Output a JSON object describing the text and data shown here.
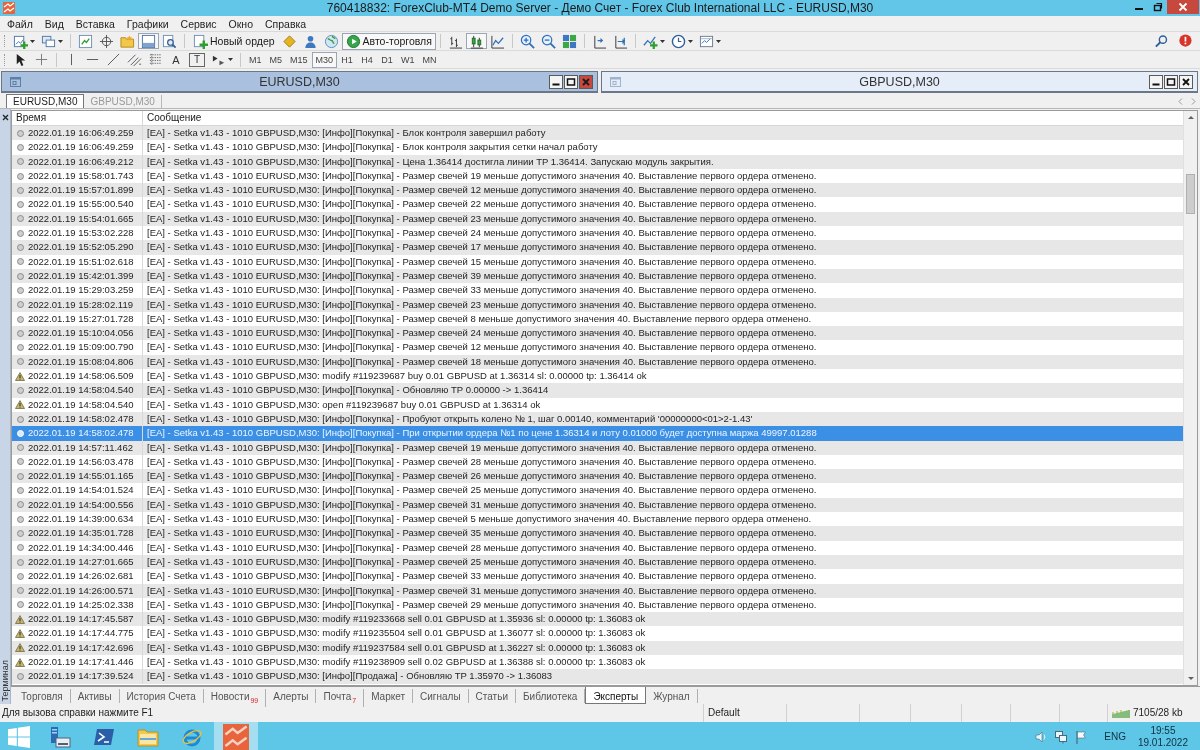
{
  "window": {
    "title": "760418832: ForexClub-MT4 Demo Server - Демо Счет - Forex Club International LLC - EURUSD,M30"
  },
  "menu": [
    "Файл",
    "Вид",
    "Вставка",
    "Графики",
    "Сервис",
    "Окно",
    "Справка"
  ],
  "toolbar": {
    "terminal_view": {
      "on": true
    },
    "new_order": "Новый ордер",
    "auto_trading": {
      "label": "Авто-торговля",
      "on": true
    },
    "chart_types": [
      {
        "selected": false
      },
      {
        "selected": true
      },
      {
        "selected": false
      }
    ]
  },
  "drawing_toolbar": {
    "text_tool": "A",
    "label_tool": "T",
    "timeframes": [
      {
        "label": "M1",
        "selected": false
      },
      {
        "label": "M5",
        "selected": false
      },
      {
        "label": "M15",
        "selected": false
      },
      {
        "label": "M30",
        "selected": true
      },
      {
        "label": "H1",
        "selected": false
      },
      {
        "label": "H4",
        "selected": false
      },
      {
        "label": "D1",
        "selected": false
      },
      {
        "label": "W1",
        "selected": false
      },
      {
        "label": "MN",
        "selected": false
      }
    ]
  },
  "chart_windows": [
    {
      "title": "EURUSD,M30",
      "active": true
    },
    {
      "title": "GBPUSD,M30",
      "active": false
    }
  ],
  "chart_tabs": [
    {
      "label": "EURUSD,M30",
      "selected": true
    },
    {
      "label": "GBPUSD,M30",
      "selected": false
    }
  ],
  "terminal": {
    "label": "Терминал",
    "columns": [
      "Время",
      "Сообщение"
    ],
    "rows": [
      {
        "kind": "info",
        "time": "2022.01.19 16:06:49.259",
        "message": "[EA] - Setka v1.43 - 1010 GBPUSD,M30: [Инфо][Покупка] - Блок контроля завершил работу",
        "selected": false
      },
      {
        "kind": "info",
        "time": "2022.01.19 16:06:49.259",
        "message": "[EA] - Setka v1.43 - 1010 GBPUSD,M30: [Инфо][Покупка] - Блок контроля закрытия сетки начал работу",
        "selected": false
      },
      {
        "kind": "info",
        "time": "2022.01.19 16:06:49.212",
        "message": "[EA] - Setka v1.43 - 1010 GBPUSD,M30: [Инфо][Покупка] - Цена 1.36414 достигла линии TP 1.36414. Запускаю модуль закрытия.",
        "selected": false
      },
      {
        "kind": "info",
        "time": "2022.01.19 15:58:01.743",
        "message": "[EA] - Setka v1.43 - 1010 EURUSD,M30: [Инфо][Покупка] - Размер свечей 19 меньше допустимого значения 40. Выставление первого ордера отменено.",
        "selected": false
      },
      {
        "kind": "info",
        "time": "2022.01.19 15:57:01.899",
        "message": "[EA] - Setka v1.43 - 1010 EURUSD,M30: [Инфо][Покупка] - Размер свечей 12 меньше допустимого значения 40. Выставление первого ордера отменено.",
        "selected": false
      },
      {
        "kind": "info",
        "time": "2022.01.19 15:55:00.540",
        "message": "[EA] - Setka v1.43 - 1010 EURUSD,M30: [Инфо][Покупка] - Размер свечей 22 меньше допустимого значения 40. Выставление первого ордера отменено.",
        "selected": false
      },
      {
        "kind": "info",
        "time": "2022.01.19 15:54:01.665",
        "message": "[EA] - Setka v1.43 - 1010 EURUSD,M30: [Инфо][Покупка] - Размер свечей 23 меньше допустимого значения 40. Выставление первого ордера отменено.",
        "selected": false
      },
      {
        "kind": "info",
        "time": "2022.01.19 15:53:02.228",
        "message": "[EA] - Setka v1.43 - 1010 EURUSD,M30: [Инфо][Покупка] - Размер свечей 24 меньше допустимого значения 40. Выставление первого ордера отменено.",
        "selected": false
      },
      {
        "kind": "info",
        "time": "2022.01.19 15:52:05.290",
        "message": "[EA] - Setka v1.43 - 1010 EURUSD,M30: [Инфо][Покупка] - Размер свечей 17 меньше допустимого значения 40. Выставление первого ордера отменено.",
        "selected": false
      },
      {
        "kind": "info",
        "time": "2022.01.19 15:51:02.618",
        "message": "[EA] - Setka v1.43 - 1010 EURUSD,M30: [Инфо][Покупка] - Размер свечей 15 меньше допустимого значения 40. Выставление первого ордера отменено.",
        "selected": false
      },
      {
        "kind": "info",
        "time": "2022.01.19 15:42:01.399",
        "message": "[EA] - Setka v1.43 - 1010 EURUSD,M30: [Инфо][Покупка] - Размер свечей 39 меньше допустимого значения 40. Выставление первого ордера отменено.",
        "selected": false
      },
      {
        "kind": "info",
        "time": "2022.01.19 15:29:03.259",
        "message": "[EA] - Setka v1.43 - 1010 EURUSD,M30: [Инфо][Покупка] - Размер свечей 33 меньше допустимого значения 40. Выставление первого ордера отменено.",
        "selected": false
      },
      {
        "kind": "info",
        "time": "2022.01.19 15:28:02.119",
        "message": "[EA] - Setka v1.43 - 1010 EURUSD,M30: [Инфо][Покупка] - Размер свечей 23 меньше допустимого значения 40. Выставление первого ордера отменено.",
        "selected": false
      },
      {
        "kind": "info",
        "time": "2022.01.19 15:27:01.728",
        "message": "[EA] - Setka v1.43 - 1010 EURUSD,M30: [Инфо][Покупка] - Размер свечей 8 меньше допустимого значения 40. Выставление первого ордера отменено.",
        "selected": false
      },
      {
        "kind": "info",
        "time": "2022.01.19 15:10:04.056",
        "message": "[EA] - Setka v1.43 - 1010 EURUSD,M30: [Инфо][Покупка] - Размер свечей 24 меньше допустимого значения 40. Выставление первого ордера отменено.",
        "selected": false
      },
      {
        "kind": "info",
        "time": "2022.01.19 15:09:00.790",
        "message": "[EA] - Setka v1.43 - 1010 EURUSD,M30: [Инфо][Покупка] - Размер свечей 12 меньше допустимого значения 40. Выставление первого ордера отменено.",
        "selected": false
      },
      {
        "kind": "info",
        "time": "2022.01.19 15:08:04.806",
        "message": "[EA] - Setka v1.43 - 1010 EURUSD,M30: [Инфо][Покупка] - Размер свечей 18 меньше допустимого значения 40. Выставление первого ордера отменено.",
        "selected": false
      },
      {
        "kind": "warning",
        "time": "2022.01.19 14:58:06.509",
        "message": "[EA] - Setka v1.43 - 1010 GBPUSD,M30: modify #119239687 buy 0.01 GBPUSD at 1.36314 sl: 0.00000 tp: 1.36414 ok",
        "selected": false
      },
      {
        "kind": "info",
        "time": "2022.01.19 14:58:04.540",
        "message": "[EA] - Setka v1.43 - 1010 GBPUSD,M30: [Инфо][Покупка] - Обновляю TP 0.00000 -> 1.36414",
        "selected": false
      },
      {
        "kind": "warning",
        "time": "2022.01.19 14:58:04.540",
        "message": "[EA] - Setka v1.43 - 1010 GBPUSD,M30: open #119239687 buy 0.01 GBPUSD at 1.36314 ok",
        "selected": false
      },
      {
        "kind": "info",
        "time": "2022.01.19 14:58:02.478",
        "message": "[EA] - Setka v1.43 - 1010 GBPUSD,M30: [Инфо][Покупка] - Пробуют открыть колено № 1, шаг 0.00140, комментарий '00000000<01>2-1.43'",
        "selected": false
      },
      {
        "kind": "info",
        "time": "2022.01.19 14:58:02.478",
        "message": "[EA] - Setka v1.43 - 1010 GBPUSD,M30: [Инфо][Покупка] - При открытии ордера №1 по цене 1.36314 и лоту 0.01000 будет доступна маржа 49997.01288",
        "selected": true
      },
      {
        "kind": "info",
        "time": "2022.01.19 14:57:11.462",
        "message": "[EA] - Setka v1.43 - 1010 GBPUSD,M30: [Инфо][Покупка] - Размер свечей 19 меньше допустимого значения 40. Выставление первого ордера отменено.",
        "selected": false
      },
      {
        "kind": "info",
        "time": "2022.01.19 14:56:03.478",
        "message": "[EA] - Setka v1.43 - 1010 GBPUSD,M30: [Инфо][Покупка] - Размер свечей 28 меньше допустимого значения 40. Выставление первого ордера отменено.",
        "selected": false
      },
      {
        "kind": "info",
        "time": "2022.01.19 14:55:01.165",
        "message": "[EA] - Setka v1.43 - 1010 GBPUSD,M30: [Инфо][Покупка] - Размер свечей 26 меньше допустимого значения 40. Выставление первого ордера отменено.",
        "selected": false
      },
      {
        "kind": "info",
        "time": "2022.01.19 14:54:01.524",
        "message": "[EA] - Setka v1.43 - 1010 EURUSD,M30: [Инфо][Покупка] - Размер свечей 25 меньше допустимого значения 40. Выставление первого ордера отменено.",
        "selected": false
      },
      {
        "kind": "info",
        "time": "2022.01.19 14:54:00.556",
        "message": "[EA] - Setka v1.43 - 1010 GBPUSD,M30: [Инфо][Покупка] - Размер свечей 31 меньше допустимого значения 40. Выставление первого ордера отменено.",
        "selected": false
      },
      {
        "kind": "info",
        "time": "2022.01.19 14:39:00.634",
        "message": "[EA] - Setka v1.43 - 1010 EURUSD,M30: [Инфо][Покупка] - Размер свечей 5 меньше допустимого значения 40. Выставление первого ордера отменено.",
        "selected": false
      },
      {
        "kind": "info",
        "time": "2022.01.19 14:35:01.728",
        "message": "[EA] - Setka v1.43 - 1010 EURUSD,M30: [Инфо][Покупка] - Размер свечей 35 меньше допустимого значения 40. Выставление первого ордера отменено.",
        "selected": false
      },
      {
        "kind": "info",
        "time": "2022.01.19 14:34:00.446",
        "message": "[EA] - Setka v1.43 - 1010 EURUSD,M30: [Инфо][Покупка] - Размер свечей 28 меньше допустимого значения 40. Выставление первого ордера отменено.",
        "selected": false
      },
      {
        "kind": "info",
        "time": "2022.01.19 14:27:01.665",
        "message": "[EA] - Setka v1.43 - 1010 EURUSD,M30: [Инфо][Покупка] - Размер свечей 25 меньше допустимого значения 40. Выставление первого ордера отменено.",
        "selected": false
      },
      {
        "kind": "info",
        "time": "2022.01.19 14:26:02.681",
        "message": "[EA] - Setka v1.43 - 1010 GBPUSD,M30: [Инфо][Покупка] - Размер свечей 33 меньше допустимого значения 40. Выставление первого ордера отменено.",
        "selected": false
      },
      {
        "kind": "info",
        "time": "2022.01.19 14:26:00.571",
        "message": "[EA] - Setka v1.43 - 1010 EURUSD,M30: [Инфо][Покупка] - Размер свечей 31 меньше допустимого значения 40. Выставление первого ордера отменено.",
        "selected": false
      },
      {
        "kind": "info",
        "time": "2022.01.19 14:25:02.338",
        "message": "[EA] - Setka v1.43 - 1010 GBPUSD,M30: [Инфо][Покупка] - Размер свечей 29 меньше допустимого значения 40. Выставление первого ордера отменено.",
        "selected": false
      },
      {
        "kind": "warning",
        "time": "2022.01.19 14:17:45.587",
        "message": "[EA] - Setka v1.43 - 1010 GBPUSD,M30: modify #119233668 sell 0.01 GBPUSD at 1.35936 sl: 0.00000 tp: 1.36083 ok",
        "selected": false
      },
      {
        "kind": "warning",
        "time": "2022.01.19 14:17:44.775",
        "message": "[EA] - Setka v1.43 - 1010 GBPUSD,M30: modify #119235504 sell 0.01 GBPUSD at 1.36077 sl: 0.00000 tp: 1.36083 ok",
        "selected": false
      },
      {
        "kind": "warning",
        "time": "2022.01.19 14:17:42.696",
        "message": "[EA] - Setka v1.43 - 1010 GBPUSD,M30: modify #119237584 sell 0.01 GBPUSD at 1.36227 sl: 0.00000 tp: 1.36083 ok",
        "selected": false
      },
      {
        "kind": "warning",
        "time": "2022.01.19 14:17:41.446",
        "message": "[EA] - Setka v1.43 - 1010 GBPUSD,M30: modify #119238909 sell 0.02 GBPUSD at 1.36388 sl: 0.00000 tp: 1.36083 ok",
        "selected": false
      },
      {
        "kind": "info",
        "time": "2022.01.19 14:17:39.524",
        "message": "[EA] - Setka v1.43 - 1010 GBPUSD,M30: [Инфо][Продажа] - Обновляю TP 1.35970 -> 1.36083",
        "selected": false
      }
    ],
    "tabs": [
      {
        "label": "Торговля",
        "selected": false
      },
      {
        "label": "Активы",
        "selected": false
      },
      {
        "label": "История Счета",
        "selected": false
      },
      {
        "label": "Новости",
        "count": "99",
        "selected": false
      },
      {
        "label": "Алерты",
        "selected": false
      },
      {
        "label": "Почта",
        "count": "7",
        "selected": false
      },
      {
        "label": "Маркет",
        "selected": false
      },
      {
        "label": "Сигналы",
        "selected": false
      },
      {
        "label": "Статьи",
        "selected": false
      },
      {
        "label": "Библиотека",
        "selected": false
      },
      {
        "label": "Эксперты",
        "selected": true
      },
      {
        "label": "Журнал",
        "selected": false
      }
    ]
  },
  "status_bar": {
    "help": "Для вызова справки нажмите F1",
    "profile": "Default",
    "traffic": "7105/28 kb"
  },
  "taskbar": {
    "apps": [
      {
        "selected": false
      },
      {
        "selected": false
      },
      {
        "selected": false
      },
      {
        "selected": false
      },
      {
        "selected": false
      },
      {
        "selected": true
      }
    ],
    "language": "ENG",
    "time": "19:55",
    "date": "19.01.2022"
  }
}
